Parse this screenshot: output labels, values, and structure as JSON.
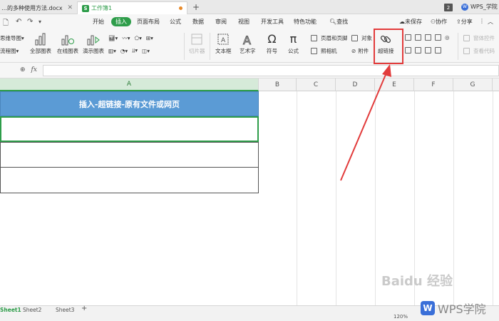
{
  "tabs": {
    "doc_tab": "…的多种使用方法.docx",
    "sheet_tab": "工作簿1",
    "count_badge": "2",
    "wps_account": "WPS_学院"
  },
  "menu": {
    "items": [
      "开始",
      "插入",
      "页面布局",
      "公式",
      "数据",
      "审阅",
      "视图",
      "开发工具",
      "特色功能",
      "查找"
    ],
    "active": "插入",
    "unsaved": "未保存",
    "collab": "协作",
    "share": "分享"
  },
  "ribbon": {
    "mindmap": "思维导图",
    "flowchart": "流程图",
    "all_charts": "全部图表",
    "online_charts": "在线图表",
    "demo_charts": "演示图表",
    "slicer": "切片器",
    "textbox": "文本框",
    "wordart": "艺术字",
    "symbol": "符号",
    "formula": "公式",
    "header_footer": "页眉和页脚",
    "object": "对象",
    "camera": "照相机",
    "attachment": "附件",
    "hyperlink": "超链接",
    "form_controls": "窗体控件",
    "view_code": "查看代码"
  },
  "formula_bar": {
    "fx_label": "fx",
    "value": ""
  },
  "grid": {
    "columns": [
      "A",
      "B",
      "C",
      "D",
      "E",
      "F",
      "G"
    ],
    "header_text": "插入-超链接-原有文件或网页"
  },
  "sheets": [
    "Sheet1",
    "Sheet2",
    "Sheet3"
  ],
  "status": {
    "zoom": "120%"
  },
  "watermarks": {
    "baidu": "Baidu 经验",
    "wps": "WPS学院",
    "wps_logo_letter": "W"
  },
  "colors": {
    "accent": "#2e9d4a",
    "header_fill": "#5b9bd5",
    "annotation": "#e23b3b"
  }
}
